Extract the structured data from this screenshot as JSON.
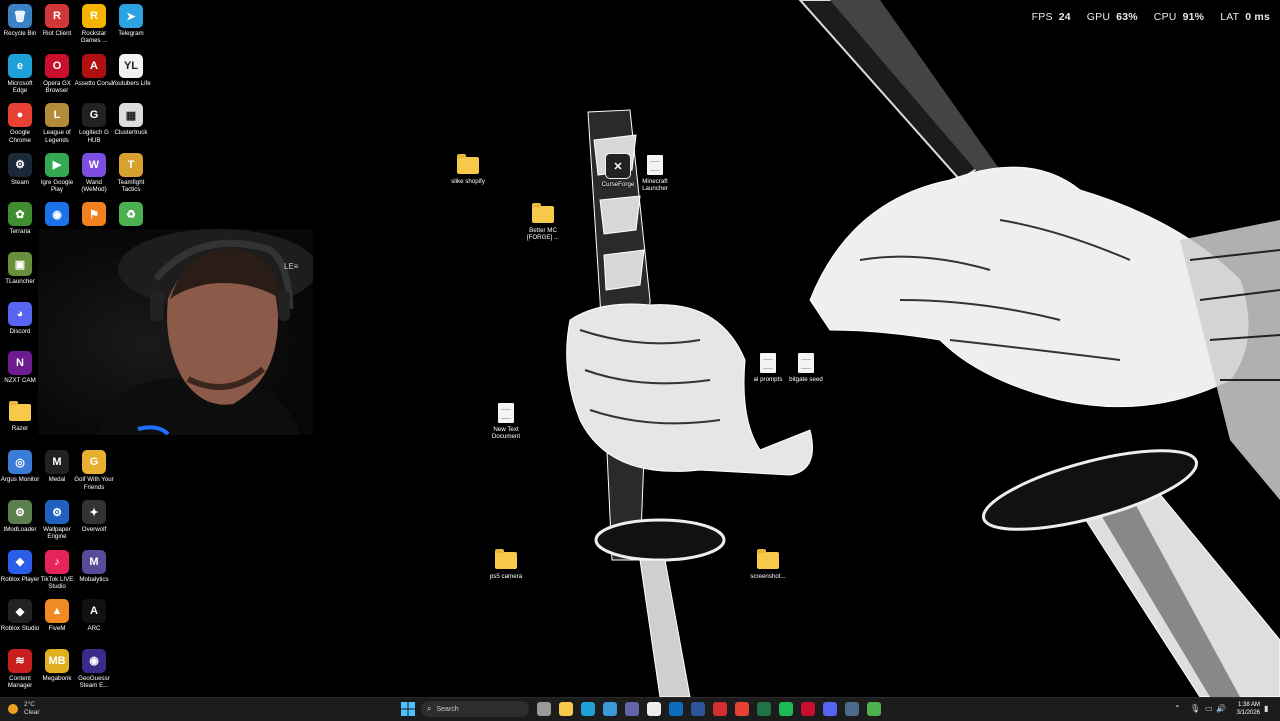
{
  "overlay": {
    "fps_label": "FPS",
    "fps_value": "24",
    "gpu_label": "GPU",
    "gpu_value": "63%",
    "cpu_label": "CPU",
    "cpu_value": "91%",
    "lat_label": "LAT",
    "lat_value": "0 ms"
  },
  "desktop_icons": [
    {
      "label": "Recycle Bin",
      "color": "#3b82c4",
      "glyph": "🗑"
    },
    {
      "label": "Riot Client",
      "color": "#d13639",
      "glyph": "R"
    },
    {
      "label": "Rockstar Games ...",
      "color": "#f4b400",
      "glyph": "R"
    },
    {
      "label": "Telegram",
      "color": "#2aa3e0",
      "glyph": "➤"
    },
    {
      "label": "Microsoft Edge",
      "color": "#1ea0d8",
      "glyph": "e"
    },
    {
      "label": "Opera GX Browser",
      "color": "#c8102e",
      "glyph": "O"
    },
    {
      "label": "Assetto Corsa",
      "color": "#b01010",
      "glyph": "A"
    },
    {
      "label": "Youtubers Life",
      "color": "#f2f2f2",
      "glyph": "YL"
    },
    {
      "label": "Google Chrome",
      "color": "#e94235",
      "glyph": "●"
    },
    {
      "label": "League of Legends",
      "color": "#b38b3b",
      "glyph": "L"
    },
    {
      "label": "Logitech G HUB",
      "color": "#222222",
      "glyph": "G"
    },
    {
      "label": "Clustertruck",
      "color": "#dddddd",
      "glyph": "▦"
    },
    {
      "label": "Steam",
      "color": "#1b2838",
      "glyph": "⚙"
    },
    {
      "label": "Igre Google Play",
      "color": "#34a853",
      "glyph": "▶"
    },
    {
      "label": "Wand (WeMod)",
      "color": "#7b4de0",
      "glyph": "W"
    },
    {
      "label": "Teamfight Tactics",
      "color": "#d6a12e",
      "glyph": "T"
    },
    {
      "label": "Terraria",
      "color": "#3f8d2f",
      "glyph": "✿"
    },
    {
      "label": "",
      "color": "#1a73e8",
      "glyph": "◉"
    },
    {
      "label": "",
      "color": "#f08020",
      "glyph": "⚑"
    },
    {
      "label": "",
      "color": "#4caf50",
      "glyph": "♻"
    },
    {
      "label": "TLauncher",
      "color": "#6a8f3a",
      "glyph": "▣"
    },
    {
      "label": "Discord",
      "color": "#5865f2",
      "glyph": "◕"
    },
    {
      "label": "NZXT CAM",
      "color": "#6c1c8e",
      "glyph": "N"
    },
    {
      "label": "Razer",
      "color": "folder",
      "glyph": ""
    },
    {
      "label": "Argus Monitor",
      "color": "#3a7bd5",
      "glyph": "◎"
    },
    {
      "label": "Medal",
      "color": "#222222",
      "glyph": "M"
    },
    {
      "label": "Golf With Your Friends",
      "color": "#e8b030",
      "glyph": "G"
    },
    {
      "label": "tModLoader",
      "color": "#5b7f4a",
      "glyph": "⚙"
    },
    {
      "label": "Wallpaper Engine",
      "color": "#1f60c0",
      "glyph": "⚙"
    },
    {
      "label": "Overwolf",
      "color": "#333333",
      "glyph": "✦"
    },
    {
      "label": "Roblox Player",
      "color": "#2a5ee8",
      "glyph": "◆"
    },
    {
      "label": "TikTok LIVE Studio",
      "color": "#e6245a",
      "glyph": "♪"
    },
    {
      "label": "Mobalytics",
      "color": "#5a4a9a",
      "glyph": "M"
    },
    {
      "label": "Roblox Studio",
      "color": "#222222",
      "glyph": "◆"
    },
    {
      "label": "FiveM",
      "color": "#f08a24",
      "glyph": "▲"
    },
    {
      "label": "ARC",
      "color": "#111111",
      "glyph": "A"
    },
    {
      "label": "Content Manager",
      "color": "#c81e1e",
      "glyph": "≋"
    },
    {
      "label": "Megabonk",
      "color": "#e0b020",
      "glyph": "MB"
    },
    {
      "label": "GeoGuessr Steam E...",
      "color": "#3c2a8a",
      "glyph": "◉"
    }
  ],
  "scattered_icons": [
    {
      "label": "slike shopify",
      "type": "folder"
    },
    {
      "label": "CurseForge",
      "type": "app"
    },
    {
      "label": "Minecraft Launcher",
      "type": "doc"
    },
    {
      "label": "Better MC [FORGE] ...",
      "type": "folder"
    },
    {
      "label": "ai prompts",
      "type": "doc"
    },
    {
      "label": "bitgate seed",
      "type": "doc"
    },
    {
      "label": "New Text Document",
      "type": "doc"
    },
    {
      "label": "ps5 camera",
      "type": "folder"
    },
    {
      "label": "screenshot...",
      "type": "folder"
    }
  ],
  "taskbar": {
    "weather_temp": "2°C",
    "weather_desc": "Clear",
    "search_placeholder": "Search",
    "time": "1:38 AM",
    "date": "3/1/2026",
    "pinned": [
      {
        "name": "task-view",
        "color": "#9a9a9a"
      },
      {
        "name": "file-explorer",
        "color": "#f6c94a"
      },
      {
        "name": "edge",
        "color": "#1ea0d8"
      },
      {
        "name": "store",
        "color": "#3a9ad9"
      },
      {
        "name": "teams",
        "color": "#6264a7"
      },
      {
        "name": "amazon",
        "color": "#eeeeee"
      },
      {
        "name": "outlook",
        "color": "#0f6cbd"
      },
      {
        "name": "word",
        "color": "#2b579a"
      },
      {
        "name": "acrobat",
        "color": "#d32f2f"
      },
      {
        "name": "chrome",
        "color": "#e94235"
      },
      {
        "name": "excel",
        "color": "#217346"
      },
      {
        "name": "spotify",
        "color": "#1db954"
      },
      {
        "name": "opera-gx",
        "color": "#c8102e"
      },
      {
        "name": "discord",
        "color": "#5865f2"
      },
      {
        "name": "steam",
        "color": "#4a6b8a"
      },
      {
        "name": "game-app",
        "color": "#4caf50"
      }
    ]
  }
}
